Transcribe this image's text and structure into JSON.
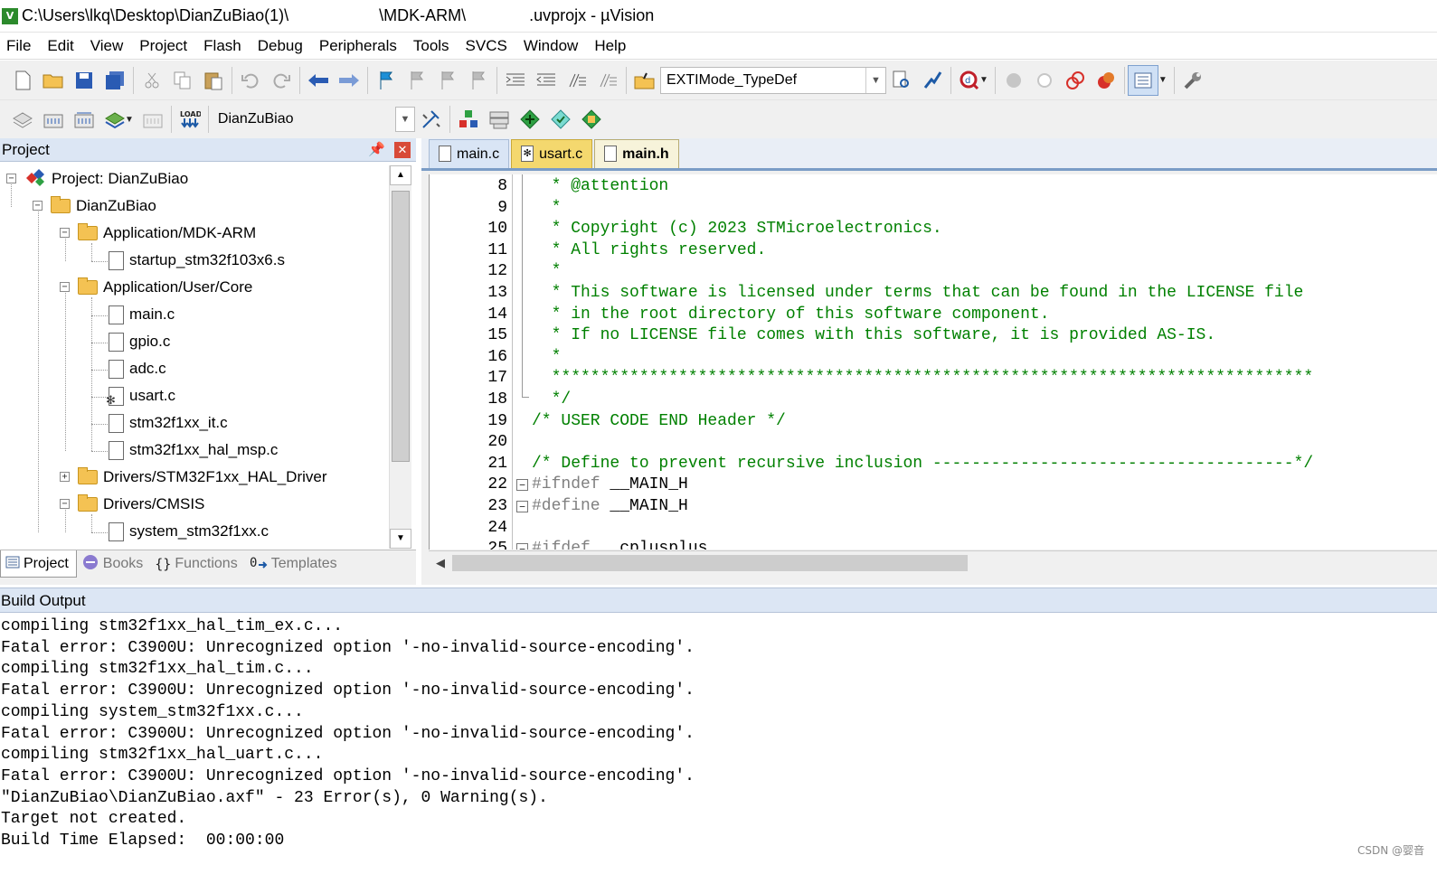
{
  "window": {
    "title": "C:\\Users\\lkq\\Desktop\\DianZuBiao(1)\\                    \\MDK-ARM\\              .uvprojx - µVision"
  },
  "menu": [
    "File",
    "Edit",
    "View",
    "Project",
    "Flash",
    "Debug",
    "Peripherals",
    "Tools",
    "SVCS",
    "Window",
    "Help"
  ],
  "toolbar1": {
    "find_combo": "EXTIMode_TypeDef"
  },
  "toolbar2": {
    "target_combo": "DianZuBiao",
    "load_label": "LOAD"
  },
  "project_panel": {
    "title": "Project",
    "tree": [
      {
        "label": "Project: DianZuBiao",
        "type": "project",
        "expanded": true
      },
      {
        "label": "DianZuBiao",
        "type": "target",
        "expanded": true
      },
      {
        "label": "Application/MDK-ARM",
        "type": "group",
        "expanded": true
      },
      {
        "label": "startup_stm32f103x6.s",
        "type": "file"
      },
      {
        "label": "Application/User/Core",
        "type": "group",
        "expanded": true
      },
      {
        "label": "main.c",
        "type": "file"
      },
      {
        "label": "gpio.c",
        "type": "file"
      },
      {
        "label": "adc.c",
        "type": "file"
      },
      {
        "label": "usart.c",
        "type": "file-options"
      },
      {
        "label": "stm32f1xx_it.c",
        "type": "file"
      },
      {
        "label": "stm32f1xx_hal_msp.c",
        "type": "file"
      },
      {
        "label": "Drivers/STM32F1xx_HAL_Driver",
        "type": "group",
        "expanded": false
      },
      {
        "label": "Drivers/CMSIS",
        "type": "group",
        "expanded": true
      },
      {
        "label": "system_stm32f1xx.c",
        "type": "file"
      }
    ],
    "tabs": [
      {
        "label": "Project",
        "active": true,
        "icon": "project-tab-icon"
      },
      {
        "label": "Books",
        "active": false,
        "icon": "books-icon"
      },
      {
        "label": "Functions",
        "active": false,
        "icon": "{}"
      },
      {
        "label": "Templates",
        "active": false,
        "icon": "templates-icon"
      }
    ]
  },
  "editor": {
    "tabs": [
      {
        "label": "main.c",
        "style": "inactive"
      },
      {
        "label": "usart.c",
        "style": "modified"
      },
      {
        "label": "main.h",
        "style": "active"
      }
    ],
    "lines": [
      {
        "n": "8",
        "text": "  * @attention",
        "kind": "comment"
      },
      {
        "n": "9",
        "text": "  *",
        "kind": "comment"
      },
      {
        "n": "10",
        "text": "  * Copyright (c) 2023 STMicroelectronics.",
        "kind": "comment"
      },
      {
        "n": "11",
        "text": "  * All rights reserved.",
        "kind": "comment"
      },
      {
        "n": "12",
        "text": "  *",
        "kind": "comment"
      },
      {
        "n": "13",
        "text": "  * This software is licensed under terms that can be found in the LICENSE file",
        "kind": "comment"
      },
      {
        "n": "14",
        "text": "  * in the root directory of this software component.",
        "kind": "comment"
      },
      {
        "n": "15",
        "text": "  * If no LICENSE file comes with this software, it is provided AS-IS.",
        "kind": "comment"
      },
      {
        "n": "16",
        "text": "  *",
        "kind": "comment"
      },
      {
        "n": "17",
        "text": "  ******************************************************************************",
        "kind": "comment"
      },
      {
        "n": "18",
        "text": "  */",
        "kind": "comment"
      },
      {
        "n": "19",
        "text": "/* USER CODE END Header */",
        "kind": "comment"
      },
      {
        "n": "20",
        "text": "",
        "kind": "comment"
      },
      {
        "n": "21",
        "text": "/* Define to prevent recursive inclusion -------------------------------------*/",
        "kind": "comment"
      },
      {
        "n": "22",
        "pp": "#ifndef ",
        "id": "__MAIN_H",
        "kind": "pp"
      },
      {
        "n": "23",
        "pp": "#define ",
        "id": "__MAIN_H",
        "kind": "pp"
      },
      {
        "n": "24",
        "text": "",
        "kind": "comment"
      },
      {
        "n": "25",
        "pp": "#ifdef ",
        "id": "__cplusplus",
        "kind": "pp"
      }
    ]
  },
  "build_output": {
    "title": "Build Output",
    "lines": [
      "compiling stm32f1xx_hal_tim_ex.c...",
      "Fatal error: C3900U: Unrecognized option '-no-invalid-source-encoding'.",
      "compiling stm32f1xx_hal_tim.c...",
      "Fatal error: C3900U: Unrecognized option '-no-invalid-source-encoding'.",
      "compiling system_stm32f1xx.c...",
      "Fatal error: C3900U: Unrecognized option '-no-invalid-source-encoding'.",
      "compiling stm32f1xx_hal_uart.c...",
      "Fatal error: C3900U: Unrecognized option '-no-invalid-source-encoding'.",
      "\"DianZuBiao\\DianZuBiao.axf\" - 23 Error(s), 0 Warning(s).",
      "Target not created.",
      "Build Time Elapsed:  00:00:00"
    ]
  },
  "watermark": "CSDN @婴音",
  "colors": {
    "comment": "#008000",
    "preprocessor": "#808080",
    "panel_header": "#dce6f4",
    "tab_modified": "#f4d86e"
  }
}
